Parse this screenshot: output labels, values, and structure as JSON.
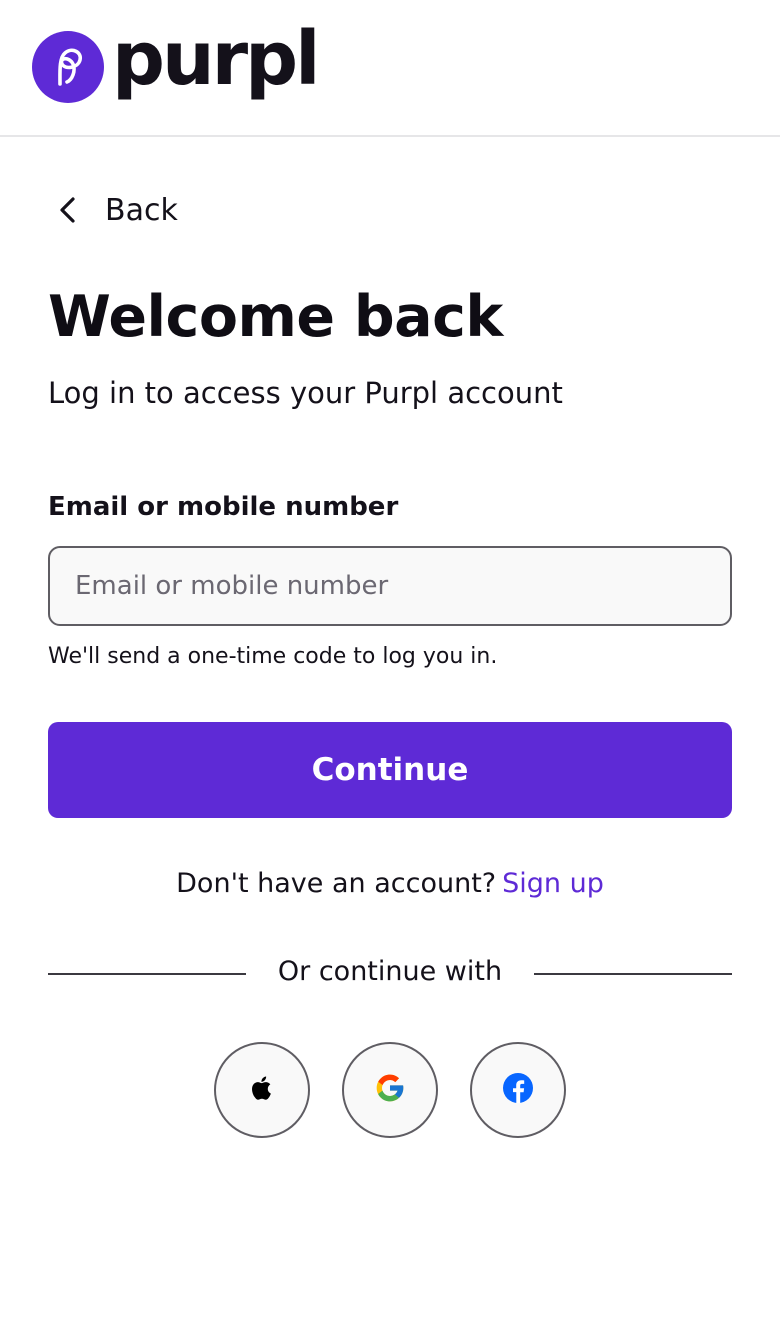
{
  "brand": {
    "name": "purpl",
    "color": "#5e2ad6"
  },
  "nav": {
    "back_label": "Back",
    "back_icon": "chevron-left-icon"
  },
  "main": {
    "title": "Welcome back",
    "subtitle": "Log in to access your Purpl account"
  },
  "form": {
    "field_label": "Email or mobile number",
    "field_placeholder": "Email or mobile number",
    "field_value": "",
    "hint": "We'll send a one-time code to log you in.",
    "submit_label": "Continue"
  },
  "signup": {
    "prompt": "Don't have an account?",
    "link_label": "Sign up"
  },
  "social": {
    "divider_text": "Or continue with",
    "providers": [
      {
        "name": "Apple",
        "icon": "apple-icon"
      },
      {
        "name": "Google",
        "icon": "google-icon"
      },
      {
        "name": "Facebook",
        "icon": "facebook-icon"
      }
    ]
  }
}
